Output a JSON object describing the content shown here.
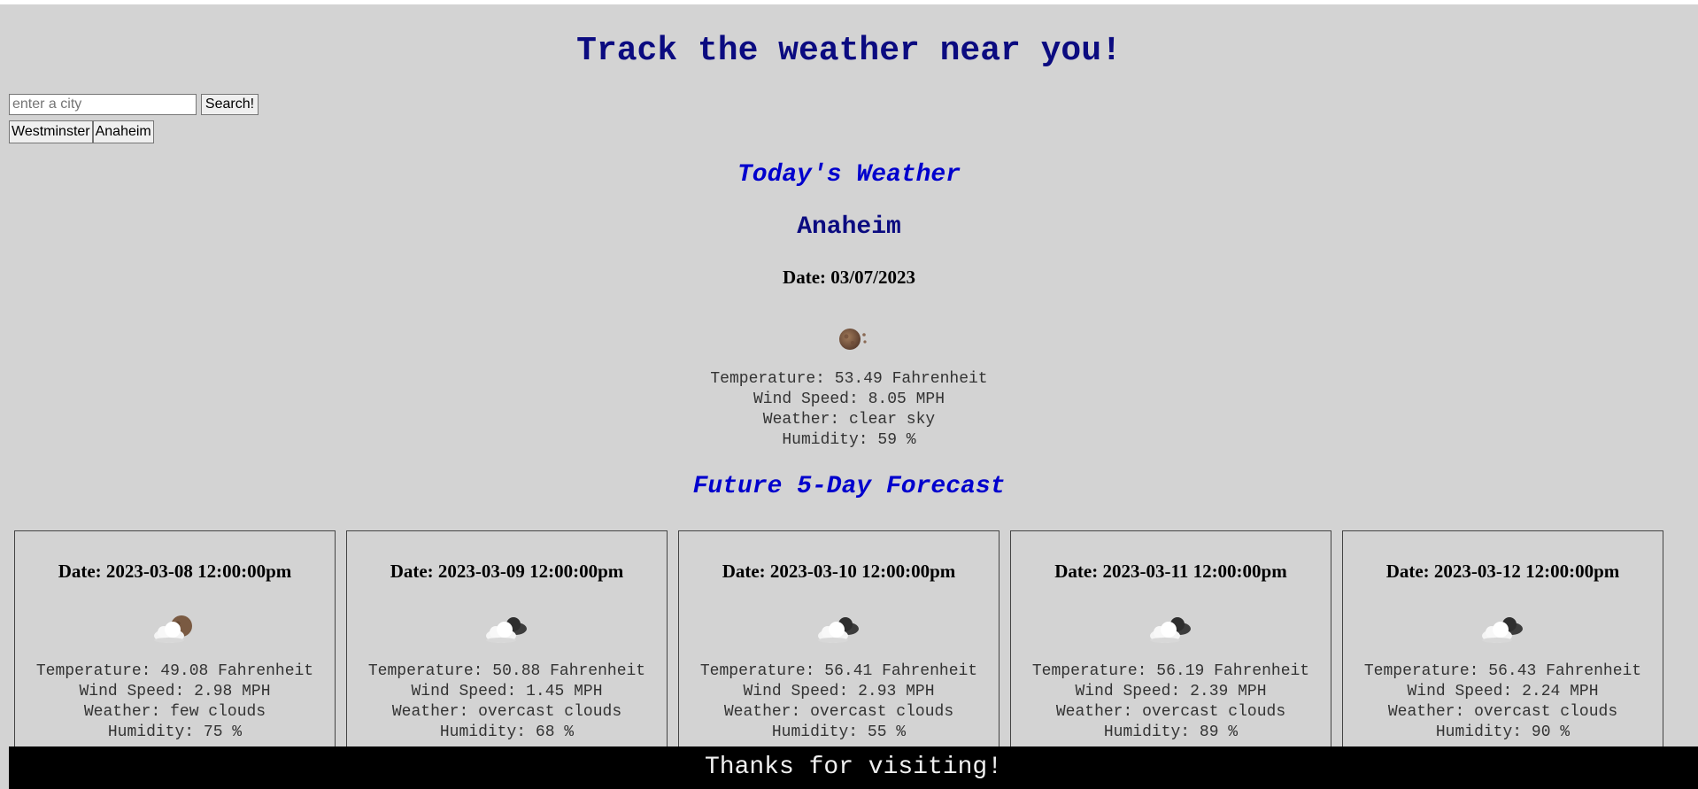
{
  "header": {
    "title": "Track the weather near you!"
  },
  "search": {
    "placeholder": "enter a city",
    "value": "",
    "button_label": "Search!"
  },
  "history": {
    "cities": [
      "Westminster",
      "Anaheim"
    ]
  },
  "today": {
    "heading": "Today's Weather",
    "city": "Anaheim",
    "date": "Date: 03/07/2023",
    "icon": "clear-sky-night-icon",
    "temperature": "Temperature: 53.49 Fahrenheit",
    "wind": "Wind Speed: 8.05 MPH",
    "weather": "Weather: clear sky",
    "humidity": "Humidity: 59 %"
  },
  "forecast": {
    "heading": "Future 5-Day Forecast",
    "days": [
      {
        "date": "Date: 2023-03-08 12:00:00pm",
        "icon": "few-clouds-night-icon",
        "temperature": "Temperature: 49.08 Fahrenheit",
        "wind": "Wind Speed: 2.98 MPH",
        "weather": "Weather: few clouds",
        "humidity": "Humidity: 75 %"
      },
      {
        "date": "Date: 2023-03-09 12:00:00pm",
        "icon": "overcast-clouds-icon",
        "temperature": "Temperature: 50.88 Fahrenheit",
        "wind": "Wind Speed: 1.45 MPH",
        "weather": "Weather: overcast clouds",
        "humidity": "Humidity: 68 %"
      },
      {
        "date": "Date: 2023-03-10 12:00:00pm",
        "icon": "overcast-clouds-icon",
        "temperature": "Temperature: 56.41 Fahrenheit",
        "wind": "Wind Speed: 2.93 MPH",
        "weather": "Weather: overcast clouds",
        "humidity": "Humidity: 55 %"
      },
      {
        "date": "Date: 2023-03-11 12:00:00pm",
        "icon": "overcast-clouds-icon",
        "temperature": "Temperature: 56.19 Fahrenheit",
        "wind": "Wind Speed: 2.39 MPH",
        "weather": "Weather: overcast clouds",
        "humidity": "Humidity: 89 %"
      },
      {
        "date": "Date: 2023-03-12 12:00:00pm",
        "icon": "overcast-clouds-icon",
        "temperature": "Temperature: 56.43 Fahrenheit",
        "wind": "Wind Speed: 2.24 MPH",
        "weather": "Weather: overcast clouds",
        "humidity": "Humidity: 90 %"
      }
    ]
  },
  "footer": {
    "text": "Thanks for visiting!"
  },
  "colors": {
    "page_background": "#d3d3d3",
    "title": "#0b0b80",
    "section_heading": "#0000cd",
    "footer_background": "#000000",
    "footer_text": "#f0f0f0"
  }
}
